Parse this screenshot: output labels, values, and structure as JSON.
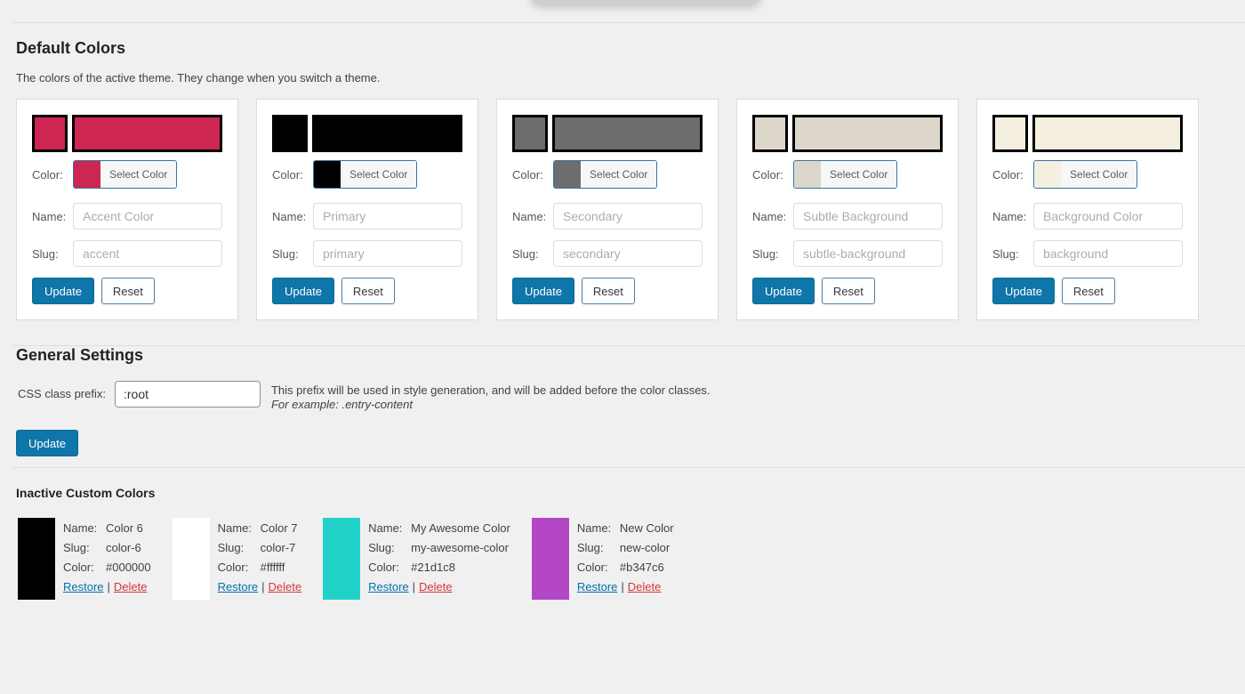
{
  "theme": {
    "primary_button_color": "#0e76a8",
    "link_blue": "#0073aa",
    "delete_red": "#d63638",
    "page_background": "#f0f0f1"
  },
  "default_colors": {
    "title": "Default Colors",
    "description": "The colors of the active theme. They change when you switch a theme.",
    "color_label": "Color:",
    "name_label": "Name:",
    "slug_label": "Slug:",
    "select_color_label": "Select Color",
    "update_label": "Update",
    "reset_label": "Reset",
    "cards": [
      {
        "color": "#cd2653",
        "name_placeholder": "Accent Color",
        "slug_placeholder": "accent"
      },
      {
        "color": "#000000",
        "name_placeholder": "Primary",
        "slug_placeholder": "primary"
      },
      {
        "color": "#6d6d6d",
        "name_placeholder": "Secondary",
        "slug_placeholder": "secondary"
      },
      {
        "color": "#dcd7ca",
        "name_placeholder": "Subtle Background",
        "slug_placeholder": "subtle-background"
      },
      {
        "color": "#f5efe0",
        "name_placeholder": "Background Color",
        "slug_placeholder": "background"
      }
    ]
  },
  "general_settings": {
    "title": "General Settings",
    "prefix_label": "CSS class prefix:",
    "prefix_value": ":root",
    "description_line1": "This prefix will be used in style generation, and will be added before the color classes.",
    "description_line2": "For example: .entry-content",
    "update_label": "Update"
  },
  "inactive_colors": {
    "title": "Inactive Custom Colors",
    "name_label": "Name:",
    "slug_label": "Slug:",
    "color_label": "Color:",
    "restore_label": "Restore",
    "delete_label": "Delete",
    "separator": "|",
    "entries": [
      {
        "swatch": "#000000",
        "name": "Color 6",
        "slug": "color-6",
        "color_value": "#000000"
      },
      {
        "swatch": "#ffffff",
        "name": "Color 7",
        "slug": "color-7",
        "color_value": "#ffffff"
      },
      {
        "swatch": "#21d1c8",
        "name": "My Awesome Color",
        "slug": "my-awesome-color",
        "color_value": "#21d1c8"
      },
      {
        "swatch": "#b347c6",
        "name": "New Color",
        "slug": "new-color",
        "color_value": "#b347c6"
      }
    ]
  }
}
